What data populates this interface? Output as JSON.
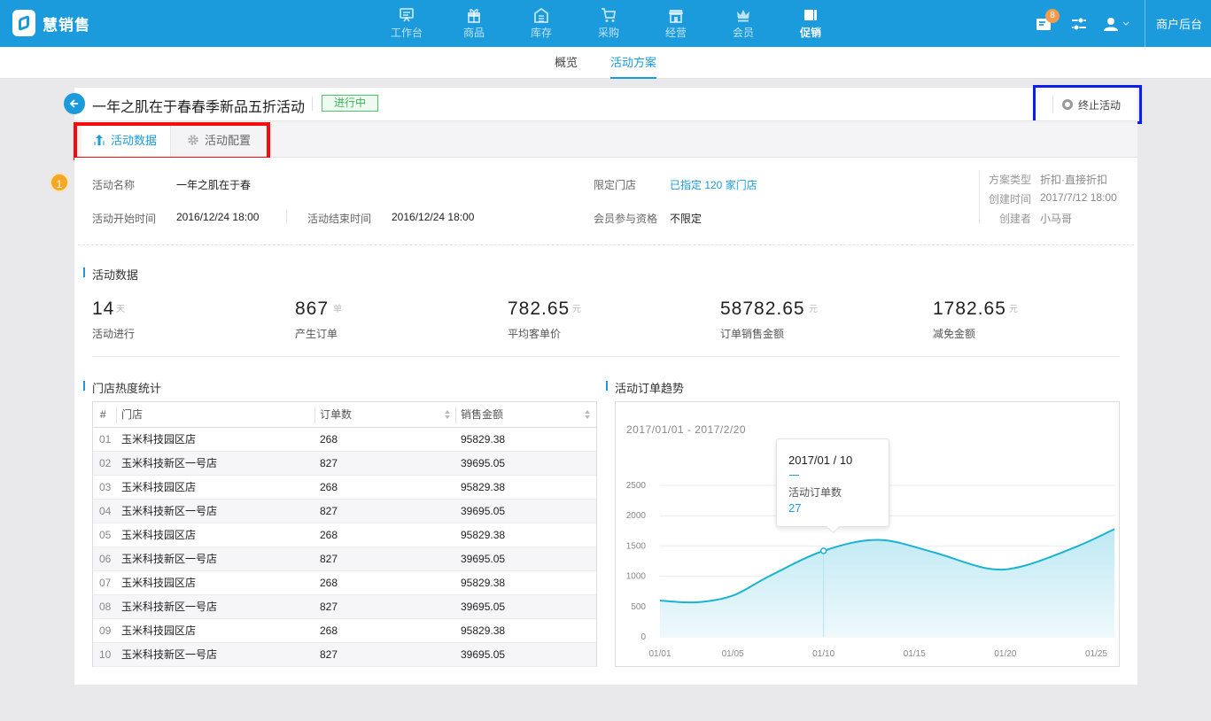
{
  "app": {
    "name": "慧销售"
  },
  "nav": {
    "items": [
      {
        "label": "工作台",
        "icon": "workbench-icon"
      },
      {
        "label": "商品",
        "icon": "gift-icon"
      },
      {
        "label": "库存",
        "icon": "warehouse-icon"
      },
      {
        "label": "采购",
        "icon": "cart-icon"
      },
      {
        "label": "经营",
        "icon": "store-icon"
      },
      {
        "label": "会员",
        "icon": "crown-icon"
      },
      {
        "label": "促销",
        "icon": "ticket-icon"
      }
    ],
    "active_index": 6
  },
  "topright": {
    "notification_count": "8",
    "merchant_label": "商户后台"
  },
  "subnav": {
    "items": [
      "概览",
      "活动方案"
    ],
    "active_index": 1
  },
  "activity": {
    "title": "一年之肌在于春春季新品五折活动",
    "status": "进行中",
    "stop_label": "终止活动"
  },
  "tabs": [
    "活动数据",
    "活动配置"
  ],
  "step": "1",
  "info": {
    "name_label": "活动名称",
    "name_value": "一年之肌在于春",
    "store_label": "限定门店",
    "store_link": "已指定 120 家门店",
    "start_label": "活动开始时间",
    "start_value": "2016/12/24 18:00",
    "end_label": "活动结束时间",
    "end_value": "2016/12/24 18:00",
    "member_label": "会员参与资格",
    "member_value": "不限定",
    "meta": [
      {
        "label": "方案类型",
        "value": "折扣·直接折扣"
      },
      {
        "label": "创建时间",
        "value": "2017/7/12 18:00"
      },
      {
        "label": "创建者",
        "value": "小马哥"
      }
    ]
  },
  "stats_title": "活动数据",
  "stats": [
    {
      "value": "14",
      "unit": "天",
      "label": "活动进行"
    },
    {
      "value": "867",
      "unit": "单",
      "label": "产生订单"
    },
    {
      "value": "782.65",
      "unit": "元",
      "label": "平均客单价"
    },
    {
      "value": "58782.65",
      "unit": "元",
      "label": "订单销售金额"
    },
    {
      "value": "1782.65",
      "unit": "元",
      "label": "减免金额"
    }
  ],
  "store_table": {
    "title": "门店热度统计",
    "columns": [
      "#",
      "门店",
      "订单数",
      "销售金额"
    ],
    "rows": [
      [
        "01",
        "玉米科技园区店",
        "268",
        "95829.38"
      ],
      [
        "02",
        "玉米科技新区一号店",
        "827",
        "39695.05"
      ],
      [
        "03",
        "玉米科技园区店",
        "268",
        "95829.38"
      ],
      [
        "04",
        "玉米科技新区一号店",
        "827",
        "39695.05"
      ],
      [
        "05",
        "玉米科技园区店",
        "268",
        "95829.38"
      ],
      [
        "06",
        "玉米科技新区一号店",
        "827",
        "39695.05"
      ],
      [
        "07",
        "玉米科技园区店",
        "268",
        "95829.38"
      ],
      [
        "08",
        "玉米科技新区一号店",
        "827",
        "39695.05"
      ],
      [
        "09",
        "玉米科技园区店",
        "268",
        "95829.38"
      ],
      [
        "10",
        "玉米科技新区一号店",
        "827",
        "39695.05"
      ]
    ]
  },
  "trend": {
    "title": "活动订单趋势",
    "range": "2017/01/01 - 2017/2/20",
    "tooltip": {
      "date": "2017/01 / 10",
      "label": "活动订单数",
      "value": "27"
    }
  },
  "chart_data": {
    "type": "area",
    "title": "活动订单趋势",
    "xlabel": "",
    "ylabel": "",
    "x_ticks": [
      "01/01",
      "01/05",
      "01/10",
      "01/15",
      "01/20",
      "01/25"
    ],
    "y_ticks": [
      0,
      500,
      1000,
      1500,
      2000,
      2500
    ],
    "ylim": [
      0,
      2500
    ],
    "xlim": [
      1,
      26
    ],
    "grid": true,
    "series": [
      {
        "x": [
          1,
          3,
          5,
          7,
          10,
          13,
          16,
          19,
          21,
          24,
          26
        ],
        "values": [
          600,
          570,
          680,
          1000,
          1420,
          1600,
          1400,
          1130,
          1170,
          1500,
          1780
        ]
      }
    ],
    "highlight": {
      "x": 10,
      "value": 1420
    },
    "colors": {
      "line": "#1bb3d4",
      "fill_top": "#bfe9f3",
      "fill_bottom": "#eef9fc"
    }
  },
  "colors": {
    "primary": "#1b9bdc",
    "status_green": "#3ab55a",
    "badge_orange": "#f39a4e",
    "step_orange": "#f5a623"
  }
}
